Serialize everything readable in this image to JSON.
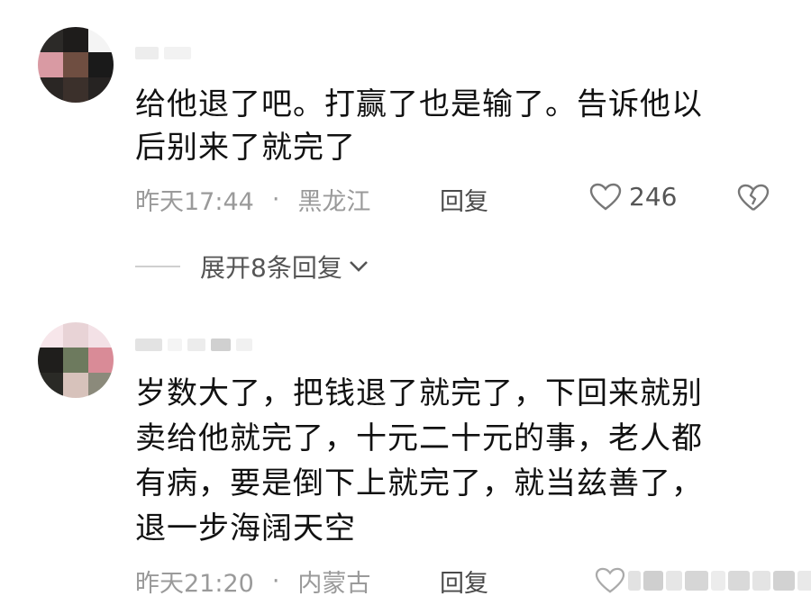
{
  "comments": [
    {
      "text_line1": "给他退了吧。打赢了也是输了。告诉他以",
      "text_line2": "后别来了就完了",
      "time": "昨天17:44",
      "separator": "·",
      "location": "黑龙江",
      "reply_label": "回复",
      "like_count": "246",
      "expand_label": "展开8条回复"
    },
    {
      "text_line1": "岁数大了，把钱退了就完了，下回来就别",
      "text_line2": "卖给他就完了，十元二十元的事，老人都",
      "text_line3": "有病，要是倒下上就完了，就当兹善了，",
      "text_line4": "退一步海阔天空",
      "time": "昨天21:20",
      "separator": "·",
      "location": "内蒙古",
      "reply_label": "回复"
    }
  ],
  "icons": {
    "like": "heart-outline-icon",
    "dislike": "broken-heart-icon",
    "expand": "chevron-down-icon"
  },
  "colors": {
    "meta_text": "#9a9a9a",
    "body_text": "#111111",
    "background": "#ffffff"
  }
}
